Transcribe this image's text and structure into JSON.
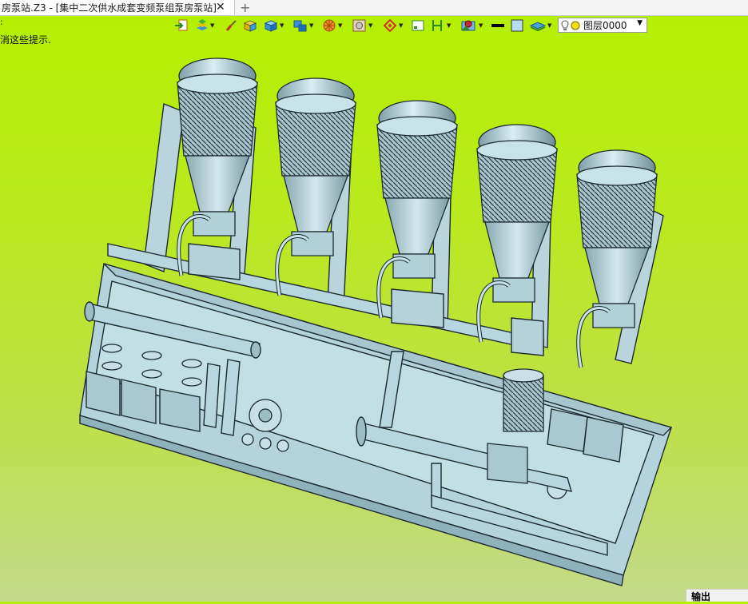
{
  "tab": {
    "title": "房泵站.Z3 - [集中二次供水成套变频泵组泵房泵站]",
    "close": "✕",
    "add": "+"
  },
  "hints": {
    "line1": ":",
    "line2": "消这些提示."
  },
  "toolbar": {
    "icons": [
      "import-icon",
      "layers-icon",
      "brush-icon",
      "shade-cube-icon",
      "display-cube-icon",
      "views-icon",
      "render-sphere-icon",
      "material-icon",
      "snap-target-icon",
      "frame-icon",
      "dimension-icon",
      "background-icon",
      "line-style-icon",
      "color-swatch-icon",
      "plane-icon"
    ],
    "layer_value": "图层0000",
    "layer_color": "#f2e400"
  },
  "output_panel": {
    "label": "输出"
  },
  "colors": {
    "viewport_top": "#b4f000",
    "viewport_bottom": "#c4d98a",
    "model": "#a8cbd4"
  }
}
